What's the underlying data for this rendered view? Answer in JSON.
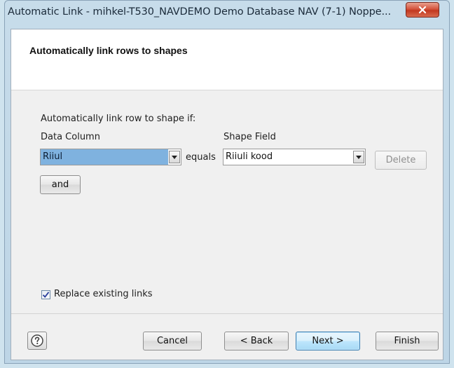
{
  "window": {
    "title": "Automatic Link - mihkel-T530_NAVDEMO Demo Database NAV (7-1) Noppe..."
  },
  "header": {
    "title": "Automatically link rows to shapes"
  },
  "form": {
    "instruction": "Automatically link row to shape if:",
    "data_column_label": "Data Column",
    "shape_field_label": "Shape Field",
    "data_column_value": "Riiul",
    "equals_label": "equals",
    "shape_field_value": "Riiuli kood",
    "delete_label": "Delete",
    "and_label": "and",
    "replace_existing_label": "Replace existing links",
    "replace_existing_checked": true
  },
  "footer": {
    "cancel_label": "Cancel",
    "back_label": "< Back",
    "next_label": "Next >",
    "finish_label": "Finish"
  },
  "icons": {
    "close": "close-icon",
    "help": "help-icon",
    "dropdown": "chevron-down-icon",
    "check": "checkmark-icon"
  },
  "colors": {
    "selection": "#7fb2df",
    "close_button": "#c9452b",
    "default_button": "#bee6fd",
    "title_background": "#c7dcea"
  }
}
